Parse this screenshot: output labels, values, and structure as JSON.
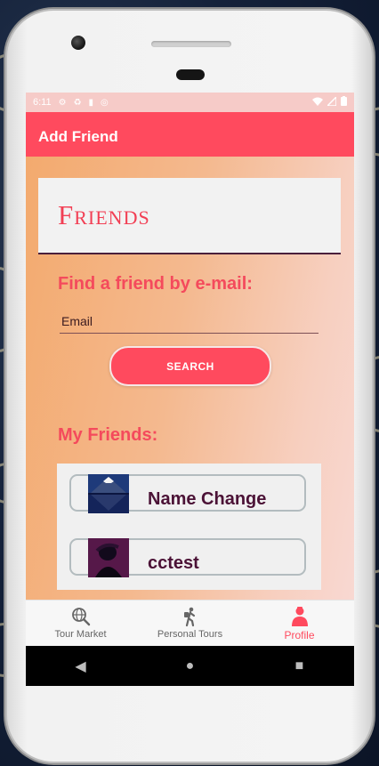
{
  "statusbar": {
    "time": "6:11",
    "left_icons": [
      "gear-icon",
      "recycle-icon",
      "sd-card-icon",
      "cast-icon"
    ],
    "right_icons": [
      "wifi-icon",
      "signal-icon",
      "battery-icon"
    ]
  },
  "appbar": {
    "title": "Add Friend"
  },
  "friends_header": {
    "title": "Friends"
  },
  "search": {
    "label": "Find a friend by e-mail:",
    "placeholder": "Email",
    "button_label": "SEARCH"
  },
  "my_friends": {
    "label": "My Friends:",
    "items": [
      {
        "name": "Name Change",
        "avatar": "mountain-photo"
      },
      {
        "name": "cctest",
        "avatar": "dark-portrait-photo"
      }
    ]
  },
  "bottom_nav": {
    "items": [
      {
        "label": "Tour Market",
        "icon": "globe-search-icon",
        "active": false
      },
      {
        "label": "Personal Tours",
        "icon": "hiker-icon",
        "active": false
      },
      {
        "label": "Profile",
        "icon": "person-icon",
        "active": true
      }
    ]
  },
  "system_nav": {
    "back": "◀",
    "home": "●",
    "recents": "■"
  },
  "colors": {
    "accent": "#ff4a5e",
    "status_bar": "#f6cbc8",
    "friend_name": "#4b1236",
    "content_gradient_start": "#f3aa6e",
    "content_gradient_end": "#f8d8d2"
  }
}
